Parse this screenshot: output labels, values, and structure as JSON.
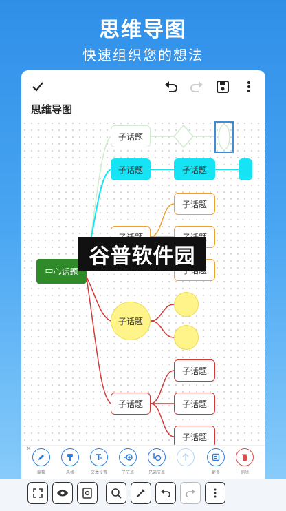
{
  "hero": {
    "title": "思维导图",
    "subtitle": "快速组织您的想法"
  },
  "document": {
    "title": "思维导图"
  },
  "mindmap": {
    "center": "中心话题",
    "subtopic": "子话题"
  },
  "actions": [
    {
      "label": "编辑",
      "icon": "pencil-icon"
    },
    {
      "label": "风格",
      "icon": "paint-roller-icon"
    },
    {
      "label": "文本设置",
      "icon": "text-format-icon"
    },
    {
      "label": "子节点",
      "icon": "add-child-node-icon"
    },
    {
      "label": "兄弟节点",
      "icon": "add-sibling-node-icon"
    },
    {
      "label": "",
      "icon": "arrow-up-icon"
    },
    {
      "label": "更多",
      "icon": "more-panel-icon"
    },
    {
      "label": "删除",
      "icon": "trash-icon"
    }
  ],
  "watermark": "谷普软件园",
  "colors": {
    "accent": "#2b7de0",
    "cyan": "#16e4f4",
    "green": "#2f8a2a",
    "orange": "#f0a030",
    "yellow": "#fff48a",
    "red": "#d23a3a"
  }
}
